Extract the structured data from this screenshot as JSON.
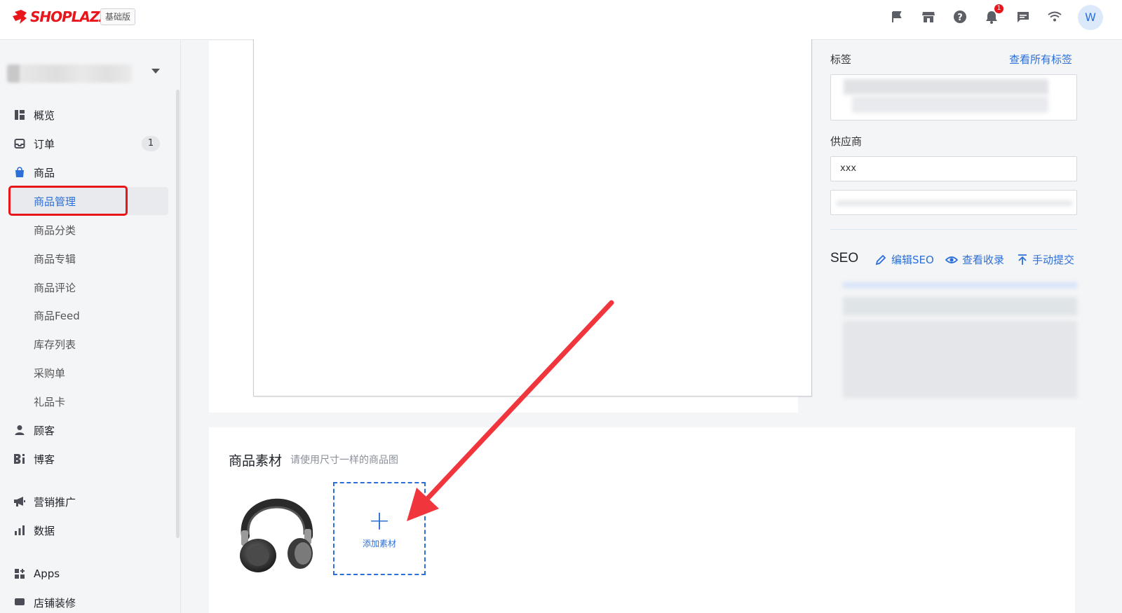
{
  "topbar": {
    "brand": "SHOPLAZZA",
    "plan_badge": "基础版",
    "icons": [
      "flag-icon",
      "store-icon",
      "help-icon",
      "bell-icon",
      "message-icon",
      "wifi-icon"
    ],
    "notification_count": "1",
    "avatar_initial": "W"
  },
  "sidebar": {
    "items": [
      {
        "label": "概览",
        "icon": "dashboard-icon"
      },
      {
        "label": "订单",
        "icon": "inbox-icon",
        "badge": "1"
      },
      {
        "label": "商品",
        "icon": "shopping-bag-icon"
      },
      {
        "label": "商品管理",
        "sub": true,
        "active": true
      },
      {
        "label": "商品分类",
        "sub": true
      },
      {
        "label": "商品专辑",
        "sub": true
      },
      {
        "label": "商品评论",
        "sub": true
      },
      {
        "label": "商品Feed",
        "sub": true
      },
      {
        "label": "库存列表",
        "sub": true
      },
      {
        "label": "采购单",
        "sub": true
      },
      {
        "label": "礼品卡",
        "sub": true
      },
      {
        "label": "顾客",
        "icon": "person-icon"
      },
      {
        "label": "博客",
        "icon": "blog-icon"
      },
      {
        "label": "营销推广",
        "icon": "megaphone-icon"
      },
      {
        "label": "数据",
        "icon": "bar-chart-icon"
      },
      {
        "label": "Apps",
        "icon": "apps-icon"
      },
      {
        "label": "店铺装修",
        "icon": "paint-icon"
      }
    ]
  },
  "panel": {
    "tags_label": "标签",
    "view_all_tags": "查看所有标签",
    "vendor_label": "供应商",
    "vendor_value": "xxx",
    "seo_title": "SEO",
    "seo_edit": "编辑SEO",
    "seo_view_index": "查看收录",
    "seo_manual_submit": "手动提交"
  },
  "material": {
    "title": "商品素材",
    "hint": "请使用尺寸一样的商品图",
    "add_label": "添加素材",
    "add_symbol": "+"
  },
  "colors": {
    "brand_red": "#e8151b",
    "link_blue": "#2c6fd8",
    "annotation_red": "#f0353d"
  }
}
